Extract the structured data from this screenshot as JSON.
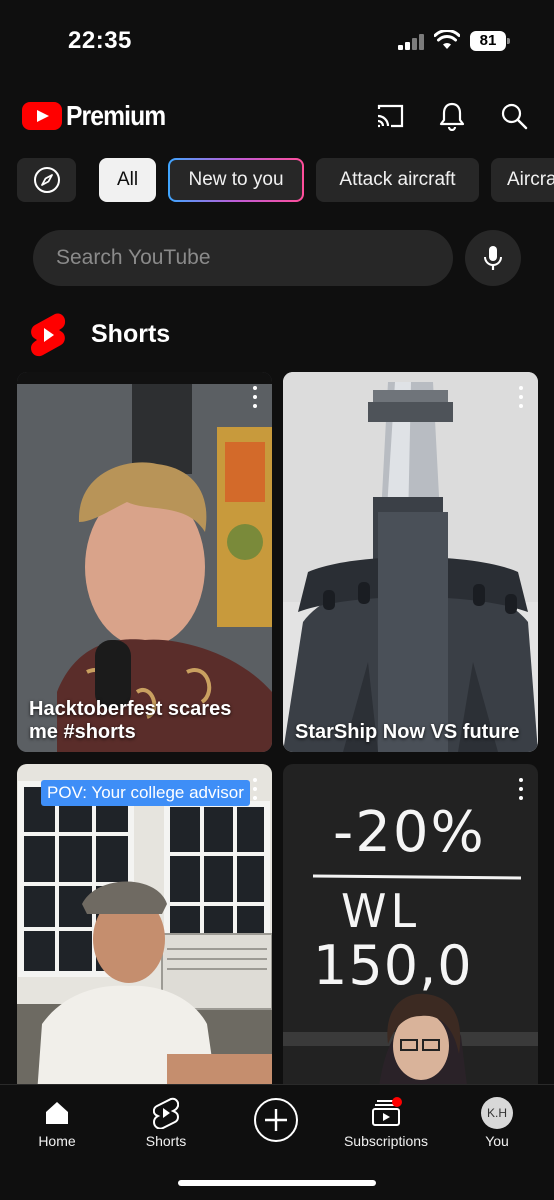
{
  "status_bar": {
    "time": "22:35",
    "battery": "81"
  },
  "header": {
    "logo_text": "Premium",
    "icons": [
      "cast-icon",
      "notifications-bell-icon",
      "search-icon"
    ]
  },
  "chips": [
    "All",
    "New to you",
    "Attack aircraft",
    "Aircraft"
  ],
  "search": {
    "placeholder": "Search YouTube"
  },
  "shorts": {
    "title": "Shorts",
    "cards": [
      {
        "caption": "Hacktoberfest scares me #shorts",
        "overlay": ""
      },
      {
        "caption": "StarShip Now VS future",
        "overlay": ""
      },
      {
        "caption": "",
        "overlay": "POV: Your college advisor"
      },
      {
        "caption": "",
        "overlay": "",
        "whiteboard": [
          "-20%",
          "WL",
          "150,0"
        ]
      }
    ]
  },
  "bottom_nav": {
    "items": [
      {
        "label": "Home",
        "icon": "home-icon"
      },
      {
        "label": "Shorts",
        "icon": "shorts-icon"
      },
      {
        "label": "",
        "icon": "create-plus-icon"
      },
      {
        "label": "Subscriptions",
        "icon": "subscriptions-icon"
      },
      {
        "label": "You",
        "icon": "avatar-icon",
        "avatar_text": "K.H"
      }
    ]
  },
  "colors": {
    "background": "#0f0f0f",
    "brand_red": "#ff0000",
    "chip_bg": "#272727",
    "chip_active_bg": "#f1f1f1"
  }
}
